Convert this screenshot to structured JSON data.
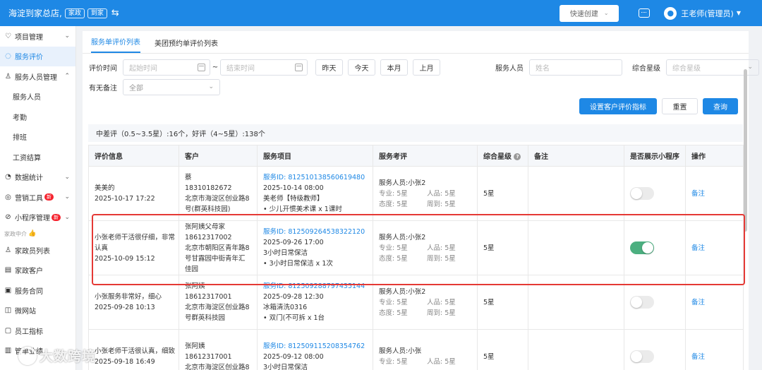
{
  "topbar": {
    "store_name": "海淀到家总店,",
    "tag_home": "家政",
    "tag_visit": "到家",
    "quick_create": "快速创建",
    "user_name": "王老师(管理员)"
  },
  "sidebar": {
    "items": [
      {
        "label": "项目管理",
        "icon": "heart-icon",
        "arrow": "⌄"
      },
      {
        "label": "服务评价",
        "icon": "chat-icon",
        "active": true
      },
      {
        "label": "服务人员管理",
        "icon": "person-icon",
        "arrow": "⌃"
      },
      {
        "label": "服务人员"
      },
      {
        "label": "考勤"
      },
      {
        "label": "排班"
      },
      {
        "label": "工资结算"
      },
      {
        "label": "数据统计",
        "icon": "pie-icon",
        "arrow": "⌄"
      },
      {
        "label": "营销工具",
        "icon": "target-icon",
        "arrow": "⌄",
        "badge": "新"
      },
      {
        "label": "小程序管理",
        "icon": "miniapp-icon",
        "arrow": "⌄",
        "badge": "新"
      }
    ],
    "section_label": "家政中介",
    "section_items": [
      {
        "label": "家政员列表",
        "icon": "person-icon"
      },
      {
        "label": "家政客户",
        "icon": "customer-icon"
      },
      {
        "label": "服务合同",
        "icon": "contract-icon"
      },
      {
        "label": "微网站",
        "icon": "web-icon"
      },
      {
        "label": "员工指标",
        "icon": "doc-icon"
      },
      {
        "label": "管单业绩",
        "icon": "chart-icon"
      }
    ]
  },
  "tabs": [
    {
      "label": "服务单评价列表",
      "active": true
    },
    {
      "label": "美团预约单评价列表"
    }
  ],
  "filters": {
    "time_label": "评价时间",
    "start_placeholder": "起始时间",
    "end_placeholder": "结束时间",
    "range_sep": "~",
    "quick": [
      "昨天",
      "今天",
      "本月",
      "上月"
    ],
    "staff_label": "服务人员",
    "staff_placeholder": "姓名",
    "rating_label": "综合星级",
    "rating_placeholder": "综合星级",
    "remark_label": "有无备注",
    "remark_value": "全部"
  },
  "actions": {
    "set_index": "设置客户评价指标",
    "reset": "重置",
    "query": "查询"
  },
  "summary": "中差评（0.5~3.5星）:16个，好评（4~5星）:138个",
  "table": {
    "headers": [
      "评价信息",
      "客户",
      "服务项目",
      "服务考评",
      "综合星级",
      "备注",
      "是否展示小程序",
      "操作"
    ],
    "rows": [
      {
        "review": "美美的",
        "date": "2025-10-17 17:22",
        "customer": [
          "蔡",
          "18310182672",
          "北京市海淀区创业路8",
          "号(群英科技园)"
        ],
        "service_id": "服务ID: 812510138560619480",
        "service_time": "2025-10-14 08:00",
        "service_name": "美老师【特级教师】",
        "service_detail": "• 少儿开惯美术课 x 1课时",
        "staff": "服务人员:小张2",
        "pro": "专业: 5星",
        "person": "人品: 5星",
        "attitude": "态度: 5星",
        "care": "周到: 5星",
        "rating": "5星",
        "show": false,
        "op": "备注"
      },
      {
        "review": "小张老师干活很仔细，非常认真",
        "date": "2025-10-09 15:12",
        "customer": [
          "张阿姨父母家",
          "18612317002",
          "北京市朝阳区青年路8",
          "号甘露园中街青年汇",
          "佳园"
        ],
        "service_id": "服务ID: 812509264538322120",
        "service_time": "2025-09-26 17:00",
        "service_name": "3小时日常保洁",
        "service_detail": "• 3小时日常保洁 x 1次",
        "staff": "服务人员:小张2",
        "pro": "专业: 5星",
        "person": "人品: 5星",
        "attitude": "态度: 5星",
        "care": "周到: 5星",
        "rating": "5星",
        "show": true,
        "op": "备注"
      },
      {
        "review": "小张服务非常好，细心",
        "date": "2025-09-28 10:13",
        "customer": [
          "张阿姨",
          "18612317001",
          "北京市海淀区创业路8",
          "号群英科技园"
        ],
        "service_id": "服务ID: 812509288797435144",
        "service_time": "2025-09-28 12:30",
        "service_name": "冰箱清洗0316",
        "service_detail": "• 双门(不可拆 x 1台",
        "staff": "服务人员:小张2",
        "pro": "专业: 5星",
        "person": "人品: 5星",
        "attitude": "态度: 5星",
        "care": "周到: 5星",
        "rating": "5星",
        "show": false,
        "op": "备注"
      },
      {
        "review": "小张老师干活很认真，细致",
        "date": "2025-09-18 16:49",
        "customer": [
          "张阿姨",
          "18612317001",
          "北京市海淀区创业路8"
        ],
        "service_id": "服务ID: 812509115208354762",
        "service_time": "2025-09-12 08:00",
        "service_name": "3小时日常保洁",
        "service_detail": "",
        "staff": "服务人员:小张",
        "pro": "专业: 5星",
        "person": "人品: 5星",
        "attitude": "",
        "care": "",
        "rating": "5星",
        "show": false,
        "op": "备注"
      }
    ]
  },
  "watermark": "大数跨境"
}
